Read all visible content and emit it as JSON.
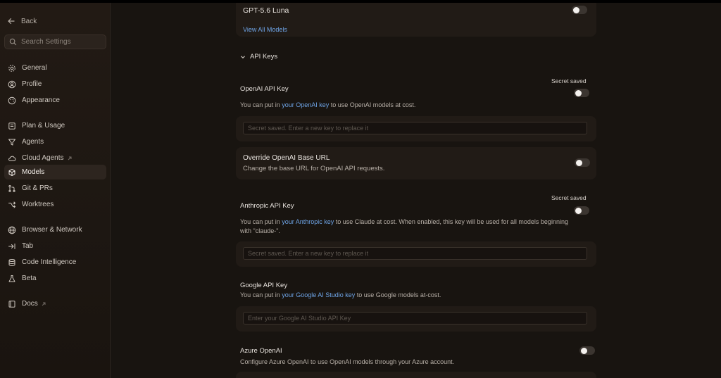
{
  "sidebar": {
    "back_label": "Back",
    "search_placeholder": "Search Settings",
    "items": [
      {
        "label": "General",
        "icon": "gear-icon"
      },
      {
        "label": "Profile",
        "icon": "user-circle-icon"
      },
      {
        "label": "Appearance",
        "icon": "palette-icon"
      },
      {
        "label": "Plan & Usage",
        "icon": "document-icon"
      },
      {
        "label": "Agents",
        "icon": "filter-icon"
      },
      {
        "label": "Cloud Agents",
        "icon": "cloud-icon",
        "external": true
      },
      {
        "label": "Models",
        "icon": "cube-icon",
        "active": true
      },
      {
        "label": "Git & PRs",
        "icon": "git-branch-icon"
      },
      {
        "label": "Worktrees",
        "icon": "worktree-icon"
      },
      {
        "label": "Browser & Network",
        "icon": "globe-icon"
      },
      {
        "label": "Tab",
        "icon": "tab-arrow-icon"
      },
      {
        "label": "Code Intelligence",
        "icon": "database-icon"
      },
      {
        "label": "Beta",
        "icon": "flask-icon"
      },
      {
        "label": "Docs",
        "icon": "book-icon",
        "external": true
      }
    ]
  },
  "models": {
    "last_model": "GPT-5.6 Luna",
    "view_all": "View All Models"
  },
  "api_keys": {
    "section_title": "API Keys",
    "openai": {
      "title": "OpenAI API Key",
      "status": "Secret saved",
      "desc_pre": "You can put in ",
      "desc_link": "your OpenAI key",
      "desc_post": " to use OpenAI models at cost.",
      "placeholder": "Secret saved. Enter a new key to replace it"
    },
    "override": {
      "title": "Override OpenAI Base URL",
      "desc": "Change the base URL for OpenAI API requests."
    },
    "anthropic": {
      "title": "Anthropic API Key",
      "status": "Secret saved",
      "desc_pre": "You can put in ",
      "desc_link": "your Anthropic key",
      "desc_post": " to use Claude at cost. When enabled, this key will be used for all models beginning",
      "desc_line2": "with \"claude-\".",
      "placeholder": "Secret saved. Enter a new key to replace it"
    },
    "google": {
      "title": "Google API Key",
      "desc_pre": "You can put in ",
      "desc_link": "your Google AI Studio key",
      "desc_post": " to use Google models at-cost.",
      "placeholder": "Enter your Google AI Studio API Key"
    },
    "azure": {
      "title": "Azure OpenAI",
      "desc": "Configure Azure OpenAI to use OpenAI models through your Azure account."
    }
  }
}
